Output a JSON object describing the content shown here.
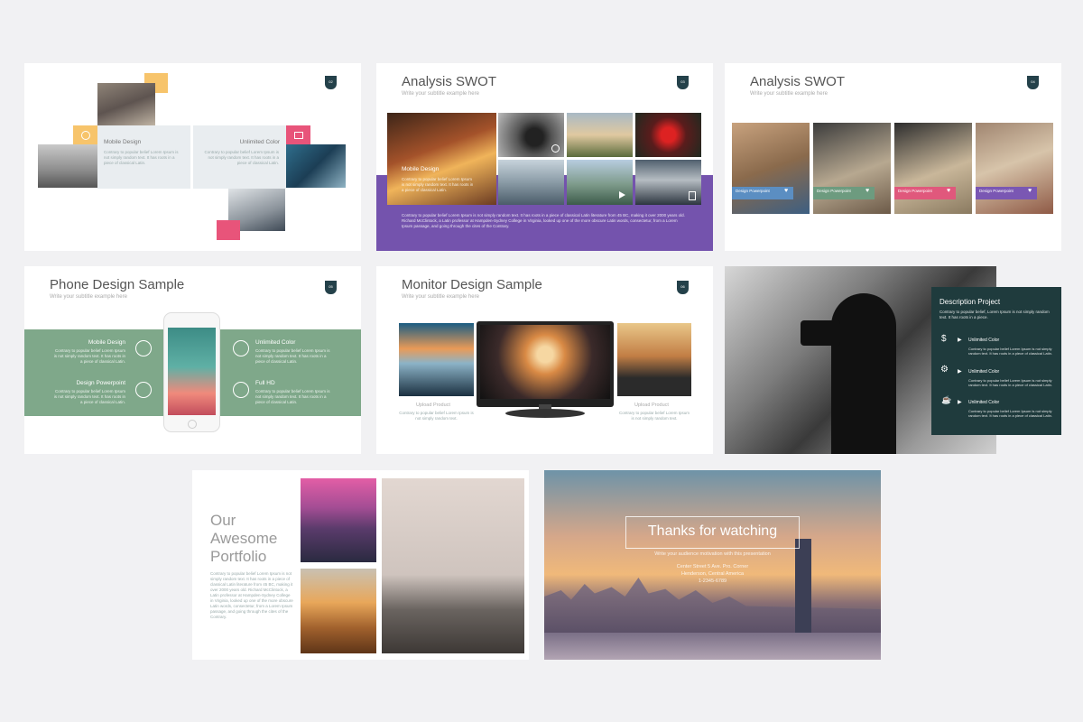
{
  "slides": {
    "s1": {
      "badge": "02",
      "left_label": "Mobile Design",
      "right_label": "Unlimited Color",
      "body": "Contrary to popular belief Lorem Ipsum is not simply random text. It has roots in a piece of classical Latin."
    },
    "s2": {
      "title": "Analysis SWOT",
      "subtitle": "Write your subtitle example here",
      "badge": "03",
      "card_label": "Mobile Design",
      "card_body": "Contrary to popular belief Lorem Ipsum is not simply random text. It has roots in a piece of classical Latin.",
      "body": "Contrary to popular belief Lorem Ipsum is not simply random text. It has roots in a piece of classical Latin literature from 45 BC, making it over 2000 years old. Richard McClintock, a Latin professor at Hampden-Sydney College in Virginia, looked up one of the more obscure Latin words, consectetur, from a Lorem Ipsum passage, and going through the cites of the Contrary."
    },
    "s3": {
      "title": "Analysis SWOT",
      "subtitle": "Write your subtitle example here",
      "badge": "04",
      "cards": [
        {
          "label": "Design Powerpoint",
          "color": "#5b8ec2"
        },
        {
          "label": "Design Powerpoint",
          "color": "#6d9b7f"
        },
        {
          "label": "Design Powerpoint",
          "color": "#e0587c"
        },
        {
          "label": "Design Powerpoint",
          "color": "#7a57b3"
        }
      ]
    },
    "s4": {
      "title": "Phone Design Sample",
      "subtitle": "Write your subtitle example here",
      "badge": "05",
      "items": [
        "Mobile Design",
        "Design Powerpoint",
        "Unlimited Color",
        "Full HD"
      ],
      "body": "Contrary to popular belief Lorem Ipsum is not simply random text. It has roots in a piece of classical Latin."
    },
    "s5": {
      "title": "Monitor Design Sample",
      "subtitle": "Write your subtitle example here",
      "badge": "06",
      "left_caption": "Upload Product",
      "right_caption": "Upload Product",
      "body": "Contrary to popular belief Lorem Ipsum is not simply random text."
    },
    "s6": {
      "panel_title": "Description Project",
      "panel_body": "Contrary to popular belief, Lorem Ipsum is not simply random text. It has roots in a piece.",
      "items": [
        "Unlimited Color",
        "Unlimited Color",
        "Unlimited Color"
      ],
      "item_body": "Contrary to popular belief Lorem Ipsum is not simply random text. It has roots in a piece of classical Latin."
    },
    "s7": {
      "title_lines": [
        "Our",
        "Awesome",
        "Portfolio"
      ],
      "body": "Contrary to popular belief Lorem Ipsum is not simply random text. It has roots in a piece of classical Latin literature from 45 BC, making it over 2000 years old. Richard McClintock, a Latin professor at Hampden-Sydney College in Virginia, looked up one of the more obscure Latin words, consectetur, from a Lorem Ipsum passage, and going through the cites of the Contrary."
    },
    "s8": {
      "title": "Thanks for watching",
      "subtitle": "Write your audience motivation with this presentation",
      "address": "Center Street 5 Ave. Pro. Corner",
      "city": "Henderson, Central America",
      "phone": "1-2345-6789"
    }
  },
  "colors": {
    "background": "#f1f1f3",
    "badge": "#24414a",
    "purple": "#7453ad",
    "green": "#7fa88a",
    "teal_panel": "#1f3b3d",
    "yellow": "#f7c46b",
    "pink": "#e8547a"
  }
}
